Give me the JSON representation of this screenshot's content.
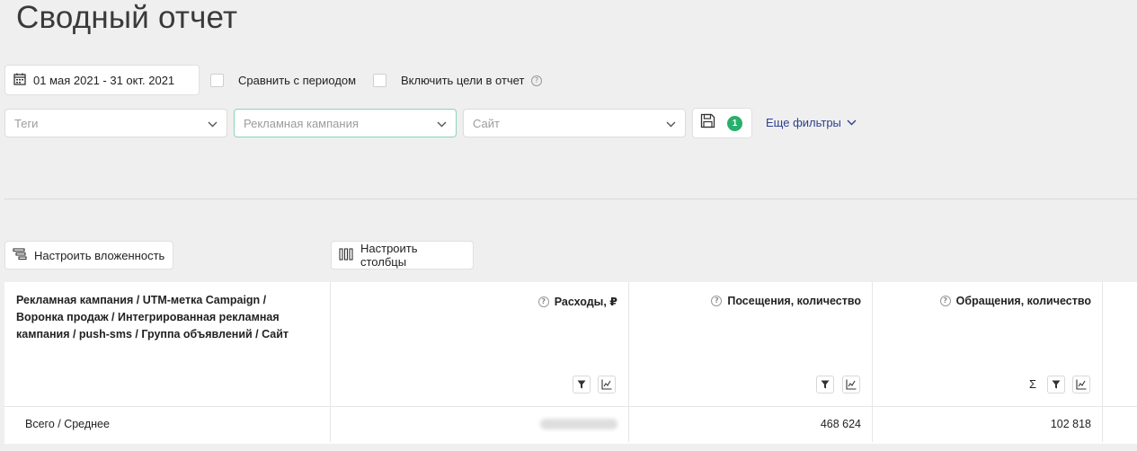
{
  "page": {
    "title": "Сводный отчет"
  },
  "period": {
    "date_range": "01 мая 2021 - 31 окт. 2021",
    "compare_label": "Сравнить с периодом",
    "include_goals_label": "Включить цели в отчет"
  },
  "filters": {
    "tags_placeholder": "Теги",
    "campaign_placeholder": "Рекламная кампания",
    "site_placeholder": "Сайт",
    "saved_count": "1",
    "more_filters_label": "Еще фильтры"
  },
  "toolbar": {
    "nesting_label": "Настроить вложенность",
    "columns_label": "Настроить столбцы"
  },
  "table": {
    "group_header": "Рекламная кампания / UTM-метка Campaign / Воронка продаж / Интегрированная рекламная кампания / push-sms / Группа объявлений / Сайт",
    "columns": [
      {
        "label": "Расходы, ₽"
      },
      {
        "label": "Посещения, количество"
      },
      {
        "label": "Обращения, количество"
      }
    ],
    "total_row": {
      "label": "Всего / Среднее",
      "values": [
        "",
        "468 624",
        "102 818"
      ]
    }
  }
}
